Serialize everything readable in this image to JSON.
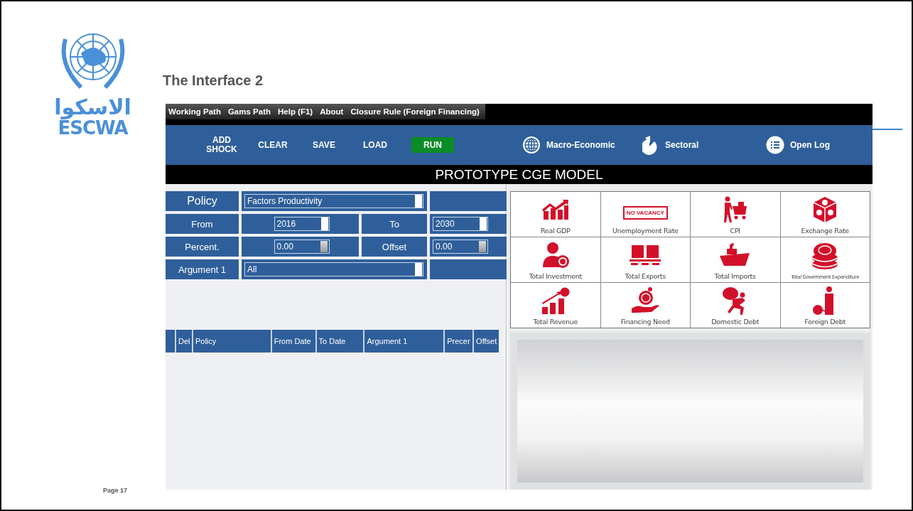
{
  "slide": {
    "logo_arabic": "الاسكوا",
    "logo_latin": "ESCWA",
    "title": "The Interface 2",
    "page": "Page 17"
  },
  "app": {
    "menu": [
      "Working Path",
      "Gams Path",
      "Help (F1)",
      "About",
      "Closure Rule (Foreign Financing)"
    ],
    "toolbar": [
      {
        "label": "ADD SHOCK",
        "kind": "plain"
      },
      {
        "label": "CLEAR",
        "kind": "plain"
      },
      {
        "label": "SAVE",
        "kind": "plain"
      },
      {
        "label": "LOAD",
        "kind": "plain"
      },
      {
        "label": "RUN",
        "kind": "primary"
      }
    ],
    "views": [
      {
        "label": "Macro-Economic"
      },
      {
        "label": "Sectoral"
      },
      {
        "label": "Open Log"
      }
    ],
    "banner": "PROTOTYPE CGE MODEL",
    "form": {
      "policy": {
        "label": "Policy",
        "value": "Factors Productivity"
      },
      "from": {
        "label": "From",
        "value": "2016"
      },
      "to": {
        "label": "To",
        "value": "2030"
      },
      "percent": {
        "label": "Percent.",
        "value": "0.00"
      },
      "offset": {
        "label": "Offset",
        "value": "0.00"
      },
      "argument": {
        "label": "Argument 1",
        "value": "All"
      }
    },
    "shocks_table": {
      "columns": [
        "Del",
        "Policy",
        "From Date",
        "To Date",
        "Argument 1",
        "Precer",
        "Offset"
      ]
    },
    "indicators": [
      {
        "label": "Real GDP"
      },
      {
        "label": "Unemployment Rate",
        "sign_text": "NO VACANCY"
      },
      {
        "label": "CPI"
      },
      {
        "label": "Exchange Rate"
      },
      {
        "label": "Total Investment"
      },
      {
        "label": "Total Exports"
      },
      {
        "label": "Total Imports"
      },
      {
        "label": "Total Government Expenditure"
      },
      {
        "label": "Total Revenue"
      },
      {
        "label": "Financing Need"
      },
      {
        "label": "Domestic Debt"
      },
      {
        "label": "Foreign Debt"
      }
    ]
  }
}
